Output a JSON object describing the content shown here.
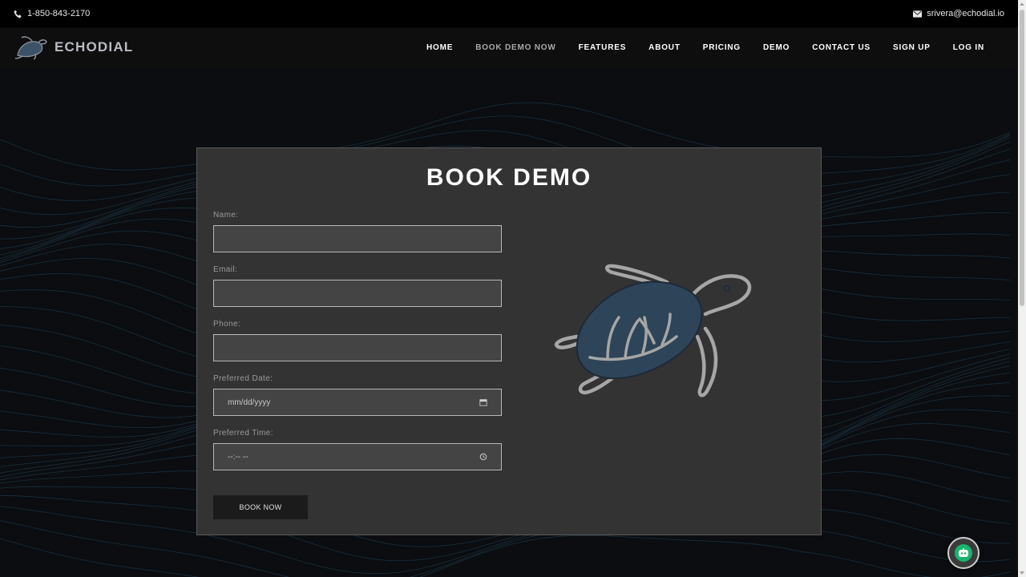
{
  "topbar": {
    "phone": "1-850-843-2170",
    "email": "srivera@echodial.io"
  },
  "brand": {
    "name": "ECHODIAL",
    "logo_icon": "turtle-logo-icon"
  },
  "nav": {
    "items": [
      {
        "label": "HOME",
        "active": false
      },
      {
        "label": "BOOK DEMO NOW",
        "active": true
      },
      {
        "label": "FEATURES",
        "active": false
      },
      {
        "label": "ABOUT",
        "active": false
      },
      {
        "label": "PRICING",
        "active": false
      },
      {
        "label": "DEMO",
        "active": false
      },
      {
        "label": "CONTACT US",
        "active": false
      },
      {
        "label": "SIGN UP",
        "active": false
      },
      {
        "label": "LOG IN",
        "active": false
      }
    ]
  },
  "form": {
    "title": "BOOK DEMO",
    "fields": {
      "name": {
        "label": "Name:",
        "value": ""
      },
      "email": {
        "label": "Email:",
        "value": ""
      },
      "phone": {
        "label": "Phone:",
        "value": ""
      },
      "date": {
        "label": "Preferred Date:",
        "placeholder": "mm/dd/yyyy",
        "icon": "calendar-icon"
      },
      "time": {
        "label": "Preferred Time:",
        "placeholder": "--:-- --",
        "icon": "clock-icon"
      }
    },
    "submit_label": "BOOK NOW"
  },
  "colors": {
    "background": "#0b0d11",
    "card": "#333333",
    "turtle_shell": "#2e4458",
    "chat_green": "#19b46d"
  },
  "chat": {
    "icon": "chatbot-icon"
  }
}
